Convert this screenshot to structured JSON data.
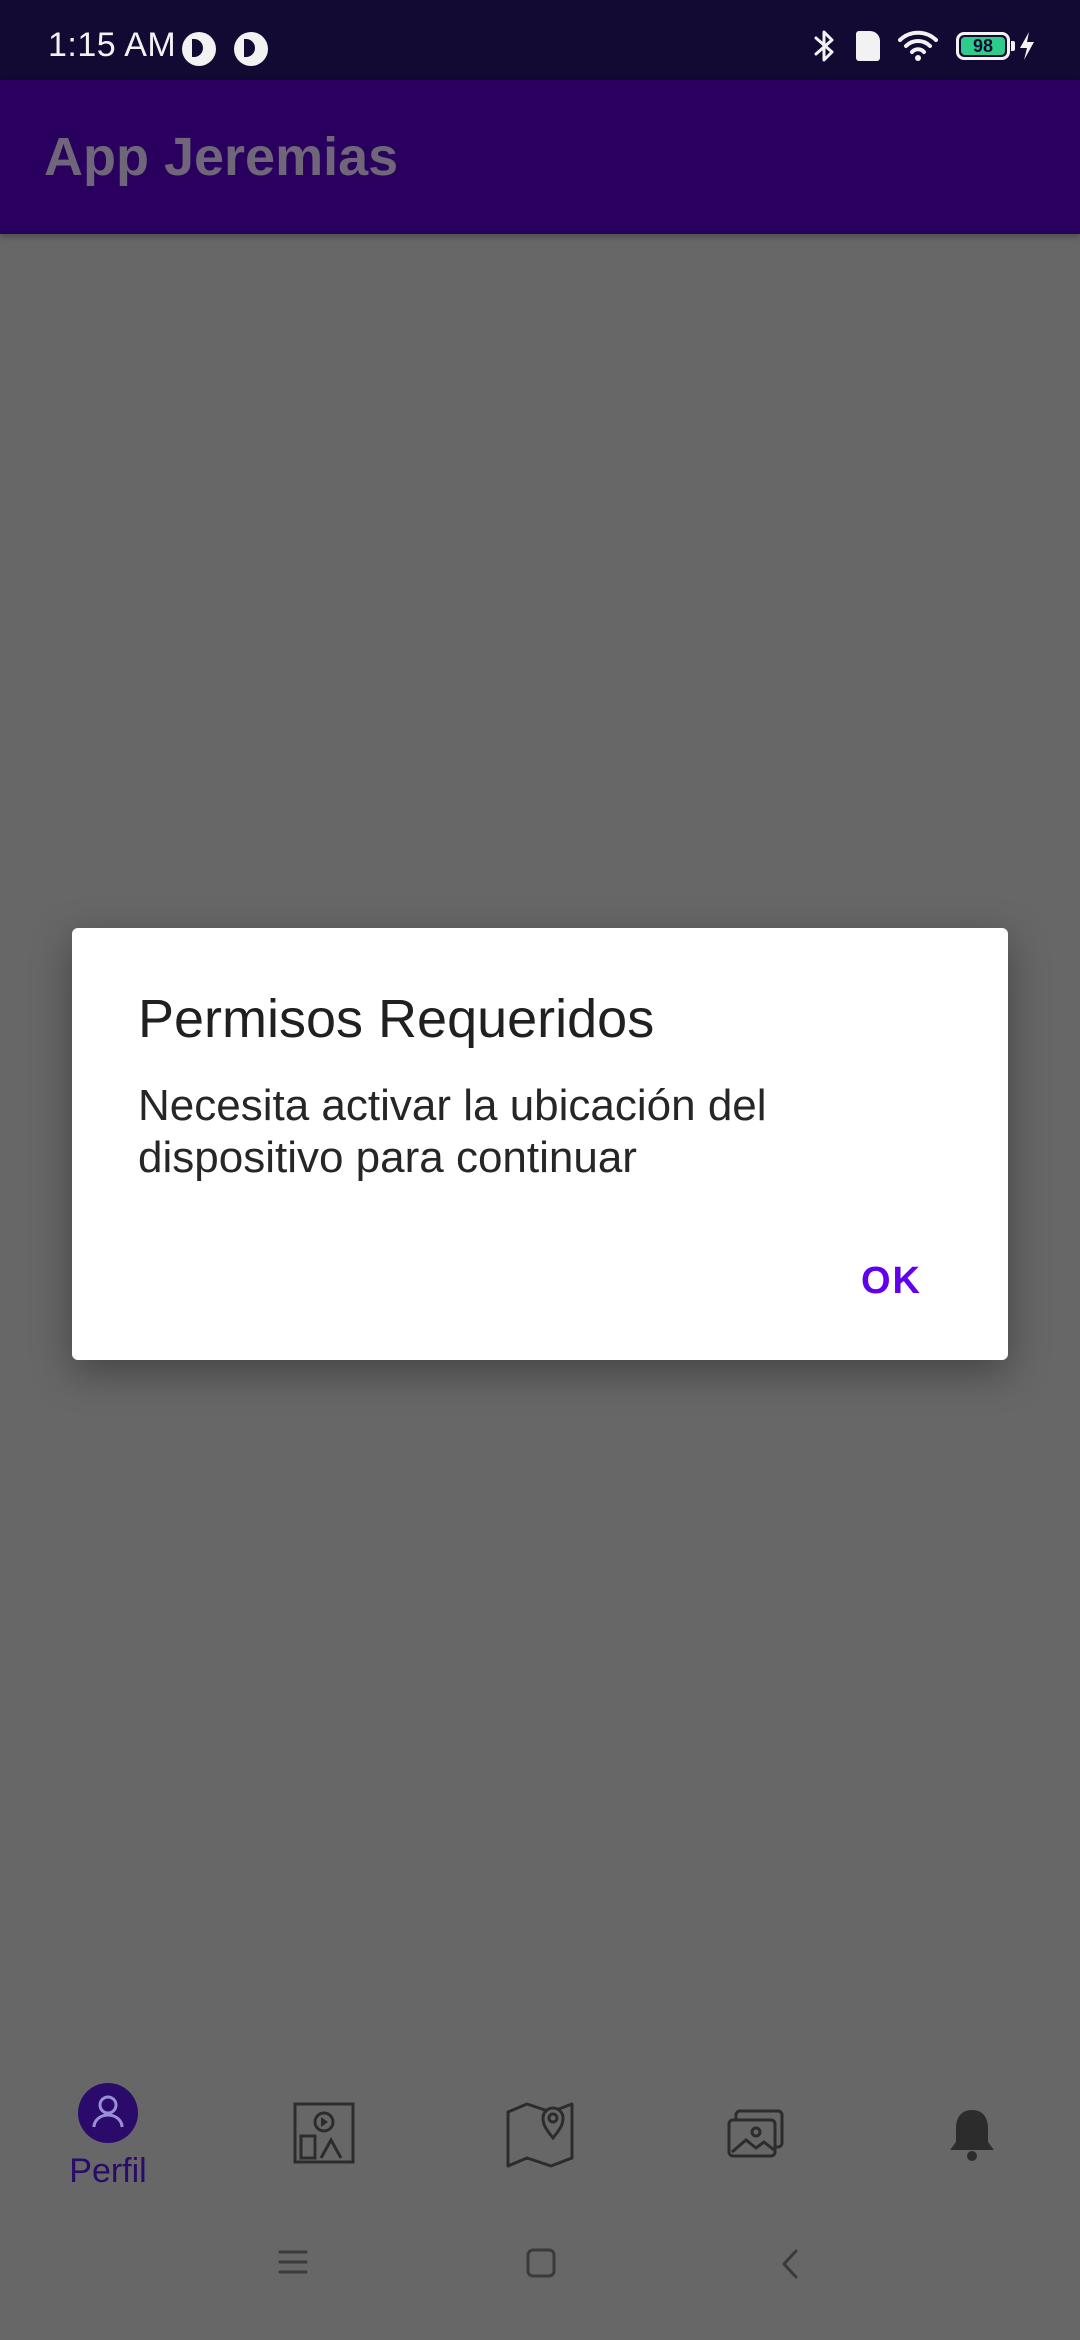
{
  "status_bar": {
    "time": "1:15 AM",
    "battery": "98",
    "icons": [
      "notification-icon",
      "notification-icon",
      "bluetooth-icon",
      "sim-icon",
      "wifi-icon",
      "battery-icon",
      "charging-icon"
    ]
  },
  "app_bar": {
    "title": "App Jeremias"
  },
  "dialog": {
    "title": "Permisos Requeridos",
    "message": "Necesita activar la ubicación del dispositivo para continuar",
    "ok_label": "OK"
  },
  "bottom_nav": {
    "items": [
      {
        "label": "Perfil",
        "icon": "profile-icon",
        "selected": true
      },
      {
        "label": "",
        "icon": "media-icon",
        "selected": false
      },
      {
        "label": "",
        "icon": "map-pin-icon",
        "selected": false
      },
      {
        "label": "",
        "icon": "gallery-icon",
        "selected": false
      },
      {
        "label": "",
        "icon": "bell-icon",
        "selected": false
      }
    ]
  },
  "colors": {
    "status_bar": "#120a33",
    "app_bar": "#29005e",
    "accent": "#6200ee",
    "scrim": "#676767",
    "nav_selected": "#2a0a6a"
  }
}
